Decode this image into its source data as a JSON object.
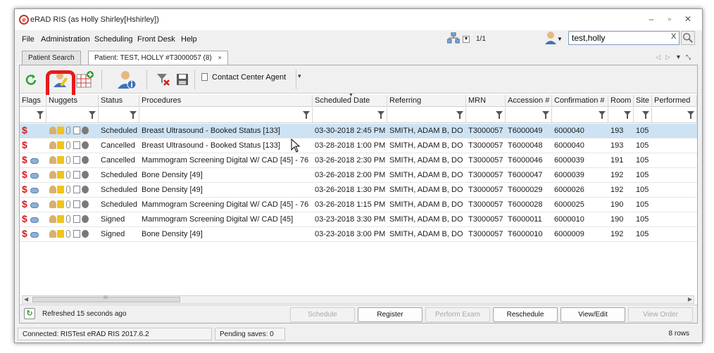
{
  "window": {
    "title": "eRAD RIS (as Holly Shirley[Hshirley])",
    "logo_letter": "e",
    "minimize": "–",
    "maximize": "▫",
    "close": "✕"
  },
  "menu": [
    "File",
    "Administration",
    "Scheduling",
    "Front Desk",
    "Help"
  ],
  "top": {
    "page_count": "1/1",
    "search_value": "test,holly",
    "search_clear": "X"
  },
  "tabs": [
    {
      "label": "Patient Search",
      "active": false
    },
    {
      "label": "Patient: TEST, HOLLY #T3000057 (8)",
      "active": true,
      "close": "×"
    }
  ],
  "toolbar": {
    "contact_center_label": "Contact Center Agent",
    "more_glyph": "▾"
  },
  "grid": {
    "columns": [
      "Flags",
      "Nuggets",
      "Status",
      "Procedures",
      "Scheduled Date",
      "Referring",
      "MRN",
      "Accession #",
      "Confirmation #",
      "Room",
      "Site",
      "Performed"
    ],
    "rows": [
      {
        "flag": "$",
        "pill": false,
        "status": "Scheduled",
        "procedure": "Breast Ultrasound - Booked Status [133]",
        "date": "03-30-2018 2:45 PM",
        "referring": "SMITH, ADAM B, DO",
        "mrn": "T3000057",
        "accession": "T6000049",
        "confirmation": "6000040",
        "room": "193",
        "site": "105",
        "selected": true
      },
      {
        "flag": "$",
        "pill": false,
        "status": "Cancelled",
        "procedure": "Breast Ultrasound - Booked Status [133]",
        "date": "03-28-2018 1:00 PM",
        "referring": "SMITH, ADAM B, DO",
        "mrn": "T3000057",
        "accession": "T6000048",
        "confirmation": "6000040",
        "room": "193",
        "site": "105",
        "selected": false
      },
      {
        "flag": "$",
        "pill": true,
        "status": "Cancelled",
        "procedure": "Mammogram Screening Digital W/ CAD [45] - 76",
        "date": "03-26-2018 2:30 PM",
        "referring": "SMITH, ADAM B, DO",
        "mrn": "T3000057",
        "accession": "T6000046",
        "confirmation": "6000039",
        "room": "191",
        "site": "105",
        "selected": false
      },
      {
        "flag": "$",
        "pill": true,
        "status": "Scheduled",
        "procedure": "Bone Density [49]",
        "date": "03-26-2018 2:00 PM",
        "referring": "SMITH, ADAM B, DO",
        "mrn": "T3000057",
        "accession": "T6000047",
        "confirmation": "6000039",
        "room": "192",
        "site": "105",
        "selected": false
      },
      {
        "flag": "$",
        "pill": true,
        "status": "Scheduled",
        "procedure": "Bone Density [49]",
        "date": "03-26-2018 1:30 PM",
        "referring": "SMITH, ADAM B, DO",
        "mrn": "T3000057",
        "accession": "T6000029",
        "confirmation": "6000026",
        "room": "192",
        "site": "105",
        "selected": false
      },
      {
        "flag": "$",
        "pill": true,
        "status": "Scheduled",
        "procedure": "Mammogram Screening Digital W/ CAD [45] - 76",
        "date": "03-26-2018 1:15 PM",
        "referring": "SMITH, ADAM B, DO",
        "mrn": "T3000057",
        "accession": "T6000028",
        "confirmation": "6000025",
        "room": "190",
        "site": "105",
        "selected": false
      },
      {
        "flag": "$",
        "pill": true,
        "status": "Signed",
        "procedure": "Mammogram Screening Digital W/ CAD [45]",
        "date": "03-23-2018 3:30 PM",
        "referring": "SMITH, ADAM B, DO",
        "mrn": "T3000057",
        "accession": "T6000011",
        "confirmation": "6000010",
        "room": "190",
        "site": "105",
        "selected": false
      },
      {
        "flag": "$",
        "pill": true,
        "status": "Signed",
        "procedure": "Bone Density [49]",
        "date": "03-23-2018 3:00 PM",
        "referring": "SMITH, ADAM B, DO",
        "mrn": "T3000057",
        "accession": "T6000010",
        "confirmation": "6000009",
        "room": "192",
        "site": "105",
        "selected": false
      }
    ]
  },
  "scrollbar": {
    "grip": "III",
    "left": "◀",
    "right": "▶"
  },
  "footer": {
    "refresh_glyph": "↻",
    "refresh_text": "Refreshed 15 seconds ago",
    "buttons": [
      {
        "label": "Schedule",
        "enabled": false
      },
      {
        "label": "Register",
        "enabled": true
      },
      {
        "label": "Perform Exam",
        "enabled": false
      },
      {
        "label": "Reschedule",
        "enabled": true
      },
      {
        "label": "View/Edit",
        "enabled": true
      },
      {
        "label": "View Order",
        "enabled": false
      }
    ]
  },
  "status": {
    "connected": "Connected: RISTest eRAD RIS 2017.6.2",
    "pending": "Pending saves: 0",
    "rows": "8 rows"
  }
}
